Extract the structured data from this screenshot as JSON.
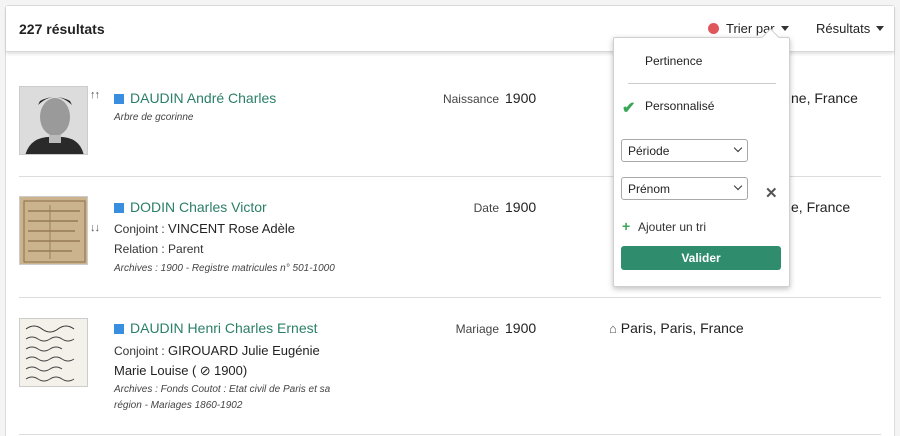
{
  "header": {
    "count": "227 résultats",
    "sort_label": "Trier par",
    "results_label": "Résultats"
  },
  "rows": [
    {
      "name": "DAUDIN André Charles",
      "detail": "Arbre de gcorinne",
      "event": "Naissance",
      "year": "1900",
      "place": "ne, France"
    },
    {
      "name": "DODIN Charles Victor",
      "spouse_label": "Conjoint :",
      "spouse": "VINCENT Rose Adèle",
      "relation_label": "Relation :",
      "relation": "Parent",
      "detail": "Archives : 1900 - Registre matricules n° 501-1000",
      "event": "Date",
      "year": "1900",
      "place": "e, France"
    },
    {
      "name": "DAUDIN Henri Charles Ernest",
      "spouse_label": "Conjoint :",
      "spouse": "GIROUARD Julie Eugénie",
      "spouse_line2": "Marie Louise (",
      "spouse_year": "1900)",
      "detail": "Archives : Fonds Coutot : Etat civil de Paris et sa",
      "detail2": "région - Mariages 1860-1902",
      "event": "Mariage",
      "year": "1900",
      "place": "Paris, Paris, France"
    }
  ],
  "sort_menu": {
    "options": [
      "Pertinence",
      "Personnalisé"
    ],
    "selects": [
      "Période",
      "Prénom"
    ],
    "add_sort": "Ajouter un tri",
    "submit": "Valider"
  },
  "colors": {
    "accent": "#2b7f67",
    "button": "#2f8c6c",
    "marker": "#3a8ee0",
    "alert": "#e0575b"
  }
}
